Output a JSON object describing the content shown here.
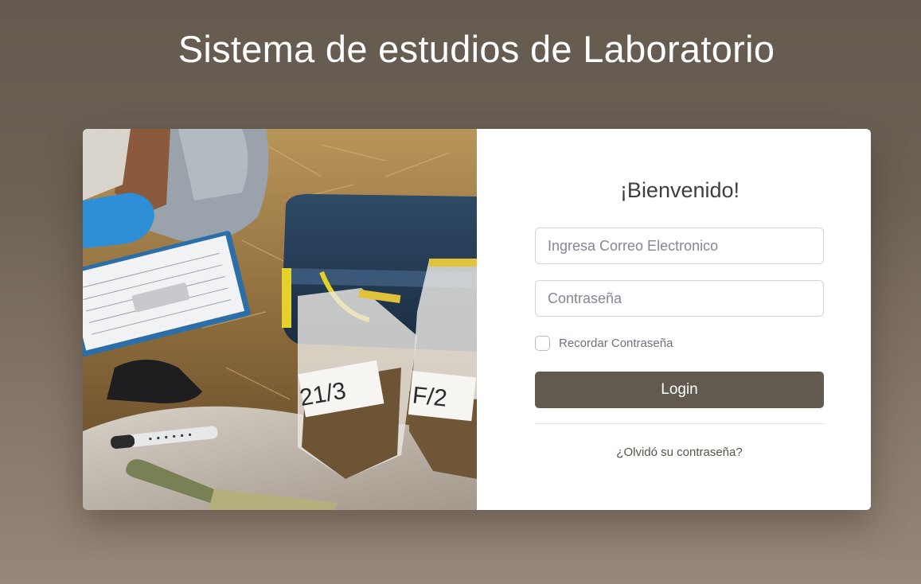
{
  "page": {
    "title": "Sistema de estudios de Laboratorio"
  },
  "photo": {
    "description_icon": "lab-soil-sample-photo",
    "bag_labels": [
      "21/3",
      "F/2"
    ]
  },
  "login_form": {
    "welcome": "¡Bienvenido!",
    "email_placeholder": "Ingresa Correo Electronico",
    "password_placeholder": "Contraseña",
    "remember_label": "Recordar Contraseña",
    "login_label": "Login",
    "forgot_label": "¿Olvidó su contraseña?"
  },
  "colors": {
    "background_top": "#645a4f",
    "background_bottom": "#968779",
    "button": "#625a4f",
    "card": "#ffffff"
  }
}
